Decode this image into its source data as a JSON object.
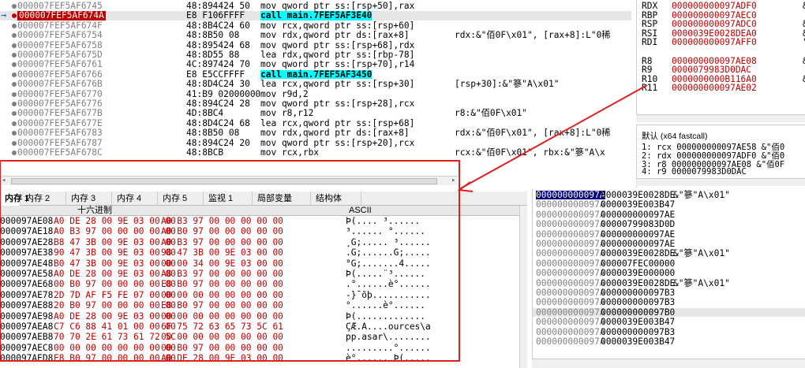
{
  "disasm": {
    "rows": [
      {
        "addr": "000007FEF5AF6745",
        "bytes": "48:894424 50",
        "instr": "mov qword ptr ss:[rsp+50],rax",
        "cmt": ""
      },
      {
        "addr": "000007FEF5AF674A",
        "bytes": "E8 F106FFFF",
        "instr": "call main.7FEF5AF3E40",
        "cmt": "",
        "current": true
      },
      {
        "addr": "000007FEF5AF674F",
        "bytes": "48:8B4C24 60",
        "instr": "mov rcx,qword ptr ss:[rsp+60]",
        "cmt": ""
      },
      {
        "addr": "000007FEF5AF6754",
        "bytes": "48:8B50 08",
        "instr": "mov rdx,qword ptr ds:[rax+8]",
        "cmt": "rdx:&\"佰0F\\x01\", [rax+8]:L\"0稀"
      },
      {
        "addr": "000007FEF5AF6758",
        "bytes": "48:895424 68",
        "instr": "mov qword ptr ss:[rsp+68],rdx",
        "cmt": ""
      },
      {
        "addr": "000007FEF5AF675D",
        "bytes": "48:8D55 88",
        "instr": "lea rdx,qword ptr ss:[rbp-78]",
        "cmt": ""
      },
      {
        "addr": "000007FEF5AF6761",
        "bytes": "4C:897424 70",
        "instr": "mov qword ptr ss:[rsp+70],r14",
        "cmt": ""
      },
      {
        "addr": "000007FEF5AF6766",
        "bytes": "E8 E5CCFFFF",
        "instr": "call main.7FEF5AF3450",
        "cmt": ""
      },
      {
        "addr": "000007FEF5AF676B",
        "bytes": "48:8D4C24 30",
        "instr": "lea rcx,qword ptr ss:[rsp+30]",
        "cmt": "[rsp+30]:&\"篸\"A\\x01\""
      },
      {
        "addr": "000007FEF5AF6770",
        "bytes": "41:B9 02000000",
        "instr": "mov r9d,2",
        "cmt": ""
      },
      {
        "addr": "000007FEF5AF6776",
        "bytes": "48:894C24 28",
        "instr": "mov qword ptr ss:[rsp+28],rcx",
        "cmt": ""
      },
      {
        "addr": "000007FEF5AF677B",
        "bytes": "4D:8BC4",
        "instr": "mov r8,r12",
        "cmt": "r8:&\"佰0F\\x01\""
      },
      {
        "addr": "000007FEF5AF677E",
        "bytes": "48:8D4C24 68",
        "instr": "lea rcx,qword ptr ss:[rsp+68]",
        "cmt": ""
      },
      {
        "addr": "000007FEF5AF6783",
        "bytes": "48:8B50 08",
        "instr": "mov rdx,qword ptr ds:[rax+8]",
        "cmt": "rdx:&\"佰0F\\x01\", [rax+8]:L\"0稀"
      },
      {
        "addr": "000007FEF5AF6787",
        "bytes": "48:894C24 20",
        "instr": "mov qword ptr ss:[rsp+20],rcx",
        "cmt": ""
      },
      {
        "addr": "000007FEF5AF678C",
        "bytes": "48:8BCB",
        "instr": "mov rcx,rbx",
        "cmt": "rcx:&\"佰0F\\x01\", rbx:&\"篸\"A\\x"
      }
    ]
  },
  "registers": {
    "rows": [
      {
        "name": "RDX",
        "val": "000000000097ADF0",
        "note": "&"
      },
      {
        "name": "RBP",
        "val": "000000000097AEC0",
        "note": ""
      },
      {
        "name": "RSP",
        "val": "000000000097ADC0",
        "note": "&"
      },
      {
        "name": "RSI",
        "val": "0000039E0028DEA0",
        "note": "&"
      },
      {
        "name": "RDI",
        "val": "000000000097AFF0",
        "note": "\""
      },
      {
        "name": "",
        "val": "",
        "note": ""
      },
      {
        "name": "R8",
        "val": "000000000097AE08",
        "note": "&"
      },
      {
        "name": "R9",
        "val": "0000079983D0DAC",
        "note": ""
      },
      {
        "name": "R10",
        "val": "0000000000B116A0",
        "note": "&"
      },
      {
        "name": "R11",
        "val": "000000000097AE02",
        "note": ""
      }
    ],
    "callconv": "默认 (x64 fastcall)",
    "args": [
      "1: rcx 000000000097AE58 &\"佰0",
      "2: rdx 000000000097ADF0 &\"佰0",
      "3: r8 000000000097AE08 &\"佰0F",
      "4: r9 0000079983D0DAC"
    ]
  },
  "tabs": [
    "内存 1",
    "内存 2",
    "内存 3",
    "内存 4",
    "内存 5",
    "监视 1",
    "局部变量",
    "结构体"
  ],
  "dump": {
    "header_hex": "十六进制",
    "header_ascii": "ASCII",
    "rows": [
      {
        "addr": "000097AE08",
        "h1": "A0 DE 28 00 9E 03 00 00",
        "h2": "A0 B3 97 00 00 00 00 00",
        "asc": "Þ(.... ³......"
      },
      {
        "addr": "000097AE18",
        "h1": "A0 B3 97 00 00 00 00 00",
        "h2": "A0 B0 97 00 00 00 00 00",
        "asc": " ³...... °......"
      },
      {
        "addr": "000097AE28",
        "h1": "B8 47 3B 00 9E 03 00 00",
        "h2": "A0 B3 97 00 00 00 00 00",
        "asc": "¸G;..... ³......"
      },
      {
        "addr": "000097AE38",
        "h1": "90 47 3B 00 9E 03 00 00",
        "h2": "98 47 3B 00 9E 03 00 00",
        "asc": ".G;......G;....."
      },
      {
        "addr": "000097AE48",
        "h1": "B0 47 3B 00 9E 03 00 00",
        "h2": "00 00 34 00 9E 03 00 00",
        "asc": "°G;.......4....."
      },
      {
        "addr": "000097AE58",
        "h1": "A0 DE 28 00 9E 03 00 00",
        "h2": "A8 B3 97 00 00 00 00 00",
        "asc": " Þ(.....¨³......"
      },
      {
        "addr": "000097AE68",
        "h1": "00 B0 97 00 00 00 00 00",
        "h2": "E8 B0 97 00 00 00 00 00",
        "asc": ".°......è°......"
      },
      {
        "addr": "000097AE78",
        "h1": "2D 7D AF F5 FE 07 00 00",
        "h2": "00 00 00 00 00 00 00 00",
        "asc": "-}¯õþ..........."
      },
      {
        "addr": "000097AE88",
        "h1": "20 B0 97 00 00 00 00 00",
        "h2": "E8 B0 97 00 00 00 00 00",
        "asc": " °......è°......"
      },
      {
        "addr": "000097AE98",
        "h1": "A0 DE 28 00 9E 03 00 00",
        "h2": "00 00 00 00 00 00 00 00",
        "asc": " Þ(............."
      },
      {
        "addr": "000097AEA8",
        "h1": "C7 C6 88 41 01 00 00 00",
        "h2": "6F 75 72 63 65 73 5C 61",
        "asc": "ÇÆ.A....ources\\a"
      },
      {
        "addr": "000097AEB8",
        "h1": "70 70 2E 61 73 61 72 5C",
        "h2": "00 00 00 00 00 00 00 00",
        "asc": "pp.asar\\........"
      },
      {
        "addr": "000097AEC8",
        "h1": "00 00 00 00 00 00 00 00",
        "h2": "00 B0 97 00 00 00 00 00",
        "asc": ".........°......"
      },
      {
        "addr": "000097AED8",
        "h1": "E8 B0 97 00 00 00 00 00",
        "h2": "A0 DE 28 00 9E 03 00 00",
        "asc": "è°...... Þ(....."
      }
    ]
  },
  "stack": {
    "rows": [
      {
        "a": "000000000097A",
        "v": "0000039E0028DE",
        "c": "&\"篸\"A\\x01\"",
        "sel": true
      },
      {
        "a": "000000000097A",
        "v": "0000039E003B47",
        "c": ""
      },
      {
        "a": "000000000097A",
        "v": "000000000097AE",
        "c": ""
      },
      {
        "a": "000000000097A",
        "v": "00000799083D0D",
        "c": ""
      },
      {
        "a": "000000000097A",
        "v": "000000000097AE",
        "c": ""
      },
      {
        "a": "000000000097A",
        "v": "000000000097AE",
        "c": ""
      },
      {
        "a": "000000000097A",
        "v": "0000039E0028DE",
        "c": "&\"篸\"A\\x01\""
      },
      {
        "a": "000000000097A",
        "v": "000007FEC00000",
        "c": ""
      },
      {
        "a": "000000000097A",
        "v": "0000039E000000",
        "c": ""
      },
      {
        "a": "000000000097A",
        "v": "0000039E0028DE",
        "c": "&\"篸\"A\\x01\""
      },
      {
        "a": "000000000097A",
        "v": "000000000097B3",
        "c": ""
      },
      {
        "a": "000000000097A",
        "v": "000000000097B3",
        "c": ""
      },
      {
        "a": "000000000097A",
        "v": "000000000097B0",
        "c": "",
        "hl": true
      },
      {
        "a": "000000000097A",
        "v": "0000039E003B47",
        "c": ""
      },
      {
        "a": "000000000097A",
        "v": "000000000097B3",
        "c": ""
      },
      {
        "a": "000000000097A",
        "v": "0000039E003B47",
        "c": ""
      }
    ]
  },
  "colors": {
    "accent_red": "#c00000",
    "call_bg": "#00ffff",
    "annotation_red": "#e02020"
  }
}
